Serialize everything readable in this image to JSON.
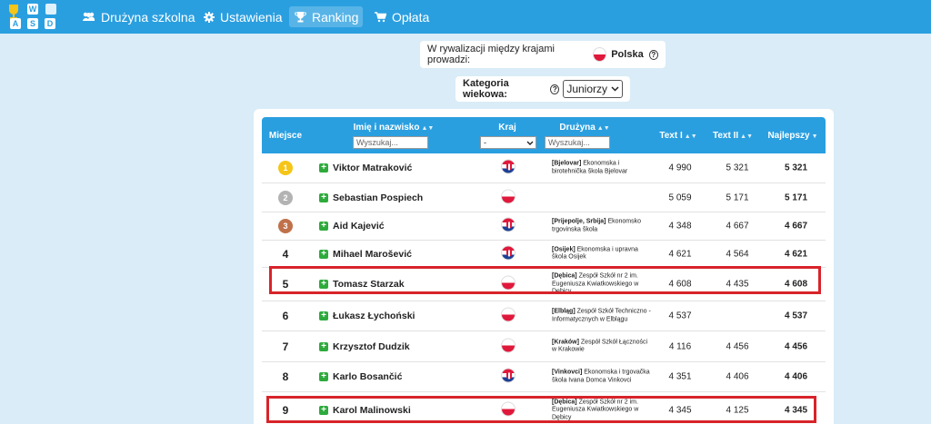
{
  "nav": {
    "logo_letters": [
      "W",
      "A",
      "S",
      "D"
    ],
    "items": [
      {
        "label": "Drużyna szkolna",
        "icon": "users-icon"
      },
      {
        "label": "Ustawienia",
        "icon": "gear-icon"
      },
      {
        "label": "Ranking",
        "icon": "trophy-icon",
        "active": true
      },
      {
        "label": "Opłata",
        "icon": "cart-icon"
      }
    ]
  },
  "country_info": {
    "label": "W rywalizacji między krajami prowadzi:",
    "country": "Polska"
  },
  "age_filter": {
    "label": "Kategoria wiekowa:",
    "value": "Juniorzy"
  },
  "table": {
    "headers": {
      "rank": "Miejsce",
      "name": "Imię i nazwisko",
      "country": "Kraj",
      "team": "Drużyna",
      "text1": "Text I",
      "text2": "Text II",
      "best": "Najlepszy"
    },
    "name_search_placeholder": "Wyszukaj...",
    "country_select_value": "-",
    "team_search_placeholder": "Wyszukaj...",
    "rows": [
      {
        "rank": "1",
        "medal": "gold",
        "name": "Viktor Matraković",
        "country": "hr",
        "team_tag": "[Bjelovar]",
        "team": " Ekonomska i birotehnička škola Bjelovar",
        "t1": "4 990",
        "t2": "5 321",
        "best": "5 321"
      },
      {
        "rank": "2",
        "medal": "silver",
        "name": "Sebastian Pospiech",
        "country": "pl",
        "team_tag": "",
        "team": "",
        "t1": "5 059",
        "t2": "5 171",
        "best": "5 171"
      },
      {
        "rank": "3",
        "medal": "bronze",
        "name": "Aid Kajević",
        "country": "hr",
        "team_tag": "[Prijepolje, Srbija]",
        "team": " Ekonomsko trgovinska škola",
        "t1": "4 348",
        "t2": "4 667",
        "best": "4 667"
      },
      {
        "rank": "4",
        "medal": "",
        "name": "Mihael Marošević",
        "country": "hr",
        "team_tag": "[Osijek]",
        "team": " Ekonomska i upravna škola Osijek",
        "t1": "4 621",
        "t2": "4 564",
        "best": "4 621"
      },
      {
        "rank": "5",
        "medal": "",
        "name": "Tomasz Starzak",
        "country": "pl",
        "team_tag": "[Dębica]",
        "team": " Zespół Szkół nr 2 im. Eugeniusza Kwiatkowskiego w Dębicy",
        "t1": "4 608",
        "t2": "4 435",
        "best": "4 608",
        "highlight": true
      },
      {
        "rank": "6",
        "medal": "",
        "name": "Łukasz Łychoński",
        "country": "pl",
        "team_tag": "[Elbląg]",
        "team": " Zespół Szkół Techniczno - Informatycznych w Elblągu",
        "t1": "4 537",
        "t2": "",
        "best": "4 537"
      },
      {
        "rank": "7",
        "medal": "",
        "name": "Krzysztof Dudzik",
        "country": "pl",
        "team_tag": "[Kraków]",
        "team": " Zespół Szkół Łączności w Krakowie",
        "t1": "4 116",
        "t2": "4 456",
        "best": "4 456"
      },
      {
        "rank": "8",
        "medal": "",
        "name": "Karlo Bosančić",
        "country": "hr",
        "team_tag": "[Vinkovci]",
        "team": " Ekonomska i trgovačka škola Ivana Domca Vinkovci",
        "t1": "4 351",
        "t2": "4 406",
        "best": "4 406"
      },
      {
        "rank": "9",
        "medal": "",
        "name": "Karol Malinowski",
        "country": "pl",
        "team_tag": "[Dębica]",
        "team": " Zespół Szkół nr 2 im. Eugeniusza Kwiatkowskiego w Dębicy",
        "t1": "4 345",
        "t2": "4 125",
        "best": "4 345",
        "highlight": true
      }
    ]
  },
  "colors": {
    "nav": "#2a9fe0",
    "background": "#d9ecf7",
    "highlight": "#d8232a",
    "gold": "#f5c518",
    "silver": "#b3b3b3",
    "bronze": "#c0714a",
    "plus": "#2eaa3c"
  }
}
